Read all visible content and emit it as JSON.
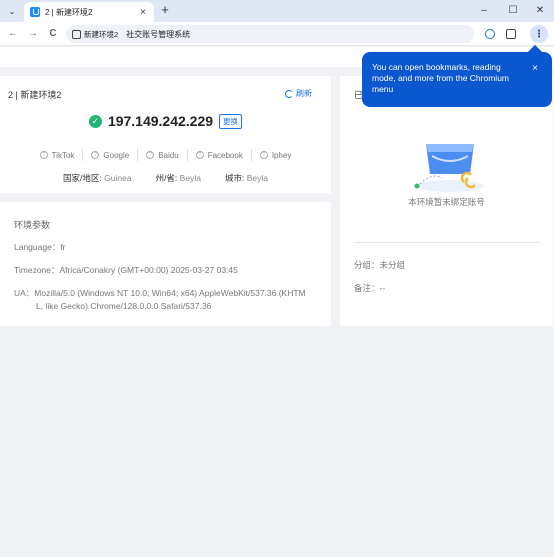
{
  "browser": {
    "tab_title": "2 | 新建环境2",
    "tab_close": "×",
    "new_tab": "+",
    "minimize": "–",
    "maximize": "☐",
    "close": "✕",
    "back": "←",
    "forward": "→",
    "reload": "C",
    "omnibox_chip": "新建环境2",
    "omnibox_text": "社交账号管理系统",
    "menu_glyph": "⋮",
    "tab_menu_glyph": "⌄"
  },
  "tooltip": {
    "text": "You can open bookmarks, reading mode, and more from the Chromium menu",
    "close": "×"
  },
  "env_card": {
    "title": "2 | 新建环境2",
    "refresh": "刷新",
    "ip": "197.149.242.229",
    "change": "更换",
    "services": [
      "TikTok",
      "Google",
      "Baidu",
      "Facebook",
      "Iphey"
    ],
    "country_label": "国家/地区:",
    "country": "Guinea",
    "state_label": "州/省:",
    "state": "Beyla",
    "city_label": "城市:",
    "city": "Beyla"
  },
  "params_card": {
    "title": "环境参数",
    "language": "Language：fr",
    "timezone": "Timezone：Africa/Conakry (GMT+00:00) 2025-03-27 03:45",
    "ua_line1": "UA：Mozilla/5.0 (Windows NT 10.0; Win64; x64) AppleWebKit/537.36 (KHTM",
    "ua_line2": "L, like Gecko) Chrome/128.0.0.0 Safari/537.36"
  },
  "right_card": {
    "title": "已",
    "empty_text": "本环境暂未绑定账号",
    "group": "分组：未分组",
    "note": "备注：--"
  }
}
